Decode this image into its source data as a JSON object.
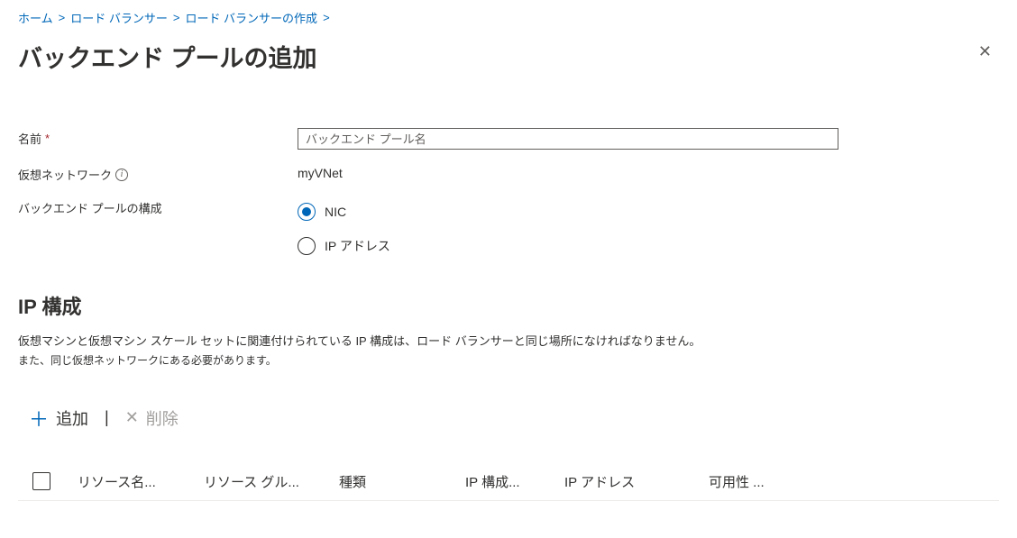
{
  "breadcrumbs": {
    "items": [
      "ホーム",
      "ロード バランサー",
      "ロード バランサーの作成"
    ]
  },
  "header": {
    "title": "バックエンド プールの追加"
  },
  "form": {
    "name_label": "名前",
    "name_placeholder": "バックエンド プール名",
    "name_value": "",
    "vnet_label": "仮想ネットワーク",
    "vnet_value": "myVNet",
    "config_label": "バックエンド プールの構成",
    "radio_nic": "NIC",
    "radio_ip": "IP アドレス"
  },
  "ipconfig": {
    "title": "IP 構成",
    "desc1": "仮想マシンと仮想マシン スケール セットに関連付けられている IP 構成は、ロード バランサーと同じ場所になければなりません。",
    "desc2": "また、同じ仮想ネットワークにある必要があります。"
  },
  "toolbar": {
    "add_label": "追加",
    "remove_label": "削除"
  },
  "table": {
    "cols": {
      "resource_name": "リソース名...",
      "resource_group": "リソース グル...",
      "type": "種類",
      "ip_config": "IP 構成...",
      "ip_address": "IP アドレス",
      "availability": "可用性  ..."
    }
  }
}
